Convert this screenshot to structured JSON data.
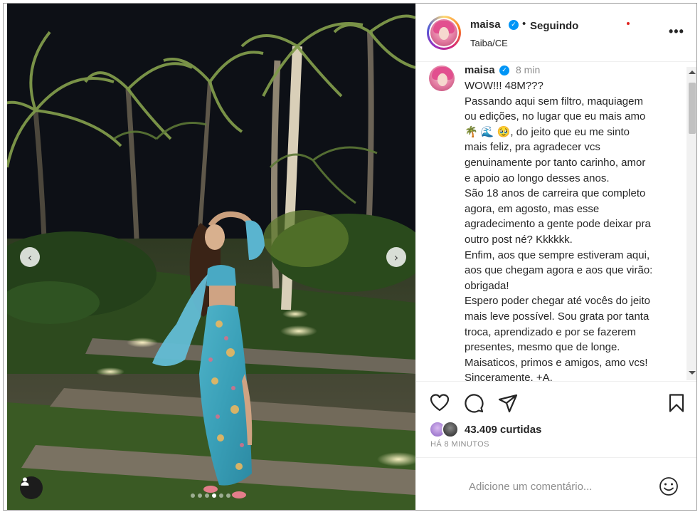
{
  "post": {
    "username": "maisa",
    "verified": true,
    "dot": "•",
    "follow_status": "Seguindo",
    "location": "Taiba/CE",
    "more_icon": "more-horizontal-icon",
    "more_label": "•••"
  },
  "caption": {
    "username": "maisa",
    "time": "8 min",
    "lines": [
      "WOW!!! 48M???",
      "Passando aqui sem filtro, maquiagem",
      "ou edições, no lugar que eu mais amo",
      "🌴 🌊 🥹, do jeito que eu me sinto",
      "mais feliz, pra agradecer vcs",
      "genuinamente por tanto carinho, amor",
      "e apoio ao longo desses anos.",
      "São 18 anos de carreira que completo",
      "agora, em agosto, mas esse",
      "agradecimento a gente pode deixar pra",
      "outro post né? Kkkkkk.",
      "Enfim, aos que sempre estiveram aqui,",
      "aos que chegam agora e aos que virão:",
      "obrigada!",
      "Espero poder chegar até vocês do jeito",
      "mais leve possível. Sou grata por tanta",
      "troca, aprendizado e por se fazerem",
      "presentes, mesmo que de longe.",
      "Maisaticos, primos e amigos, amo vcs!",
      "Sinceramente, +A."
    ]
  },
  "actions": {
    "like_icon": "heart-icon",
    "comment_icon": "comment-icon",
    "share_icon": "send-icon",
    "save_icon": "bookmark-icon"
  },
  "likes": {
    "count_text": "43.409 curtidas",
    "time_ago": "HÁ 8 MINUTOS"
  },
  "comment": {
    "placeholder": "Adicione um comentário...",
    "emoji_icon": "smiley-icon"
  },
  "media": {
    "prev_icon": "chevron-left-icon",
    "next_icon": "chevron-right-icon",
    "prev_glyph": "‹",
    "next_glyph": "›",
    "tag_icon": "user-tag-icon",
    "slide_count": 6,
    "active_slide": 4
  },
  "colors": {
    "verified_blue": "#0095f6",
    "text": "#262626",
    "muted": "#8e8e8e",
    "divider": "#efefef"
  }
}
